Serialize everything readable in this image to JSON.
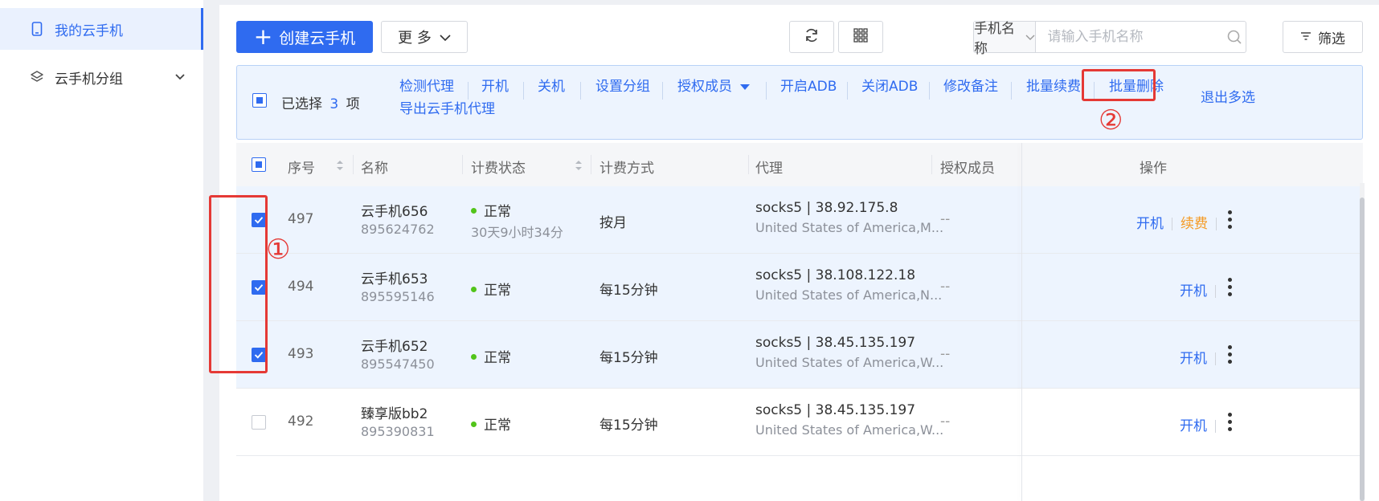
{
  "sidebar": {
    "items": [
      {
        "label": "我的云手机",
        "icon": "phone-icon",
        "active": true
      },
      {
        "label": "云手机分组",
        "icon": "layers-icon",
        "active": false
      }
    ]
  },
  "toolbar": {
    "create_label": "创建云手机",
    "more_label": "更 多",
    "search_field_label": "手机名称",
    "search_placeholder": "请输入手机名称",
    "filter_label": "筛选"
  },
  "selection_bar": {
    "prefix": "已选择",
    "count": "3",
    "suffix": "项",
    "actions": [
      "检测代理",
      "开机",
      "关机",
      "设置分组",
      "授权成员",
      "开启ADB",
      "关闭ADB",
      "修改备注",
      "批量续费",
      "批量删除"
    ],
    "action_row2": "导出云手机代理",
    "exit_label": "退出多选"
  },
  "table": {
    "headers": {
      "index": "序号",
      "name": "名称",
      "billing_status": "计费状态",
      "billing_method": "计费方式",
      "proxy": "代理",
      "members": "授权成员",
      "ops": "操作"
    },
    "rows": [
      {
        "checked": true,
        "index": "497",
        "name": "云手机656",
        "id": "895624762",
        "status": "正常",
        "remaining": "30天9小时34分",
        "method": "按月",
        "proxy": "socks5 | 38.92.175.8",
        "location": "United States of America,M...",
        "members": "--",
        "op_power": "开机",
        "op_renew": "续费"
      },
      {
        "checked": true,
        "index": "494",
        "name": "云手机653",
        "id": "895595146",
        "status": "正常",
        "remaining": "",
        "method": "每15分钟",
        "proxy": "socks5 | 38.108.122.18",
        "location": "United States of America,N...",
        "members": "--",
        "op_power": "开机",
        "op_renew": ""
      },
      {
        "checked": true,
        "index": "493",
        "name": "云手机652",
        "id": "895547450",
        "status": "正常",
        "remaining": "",
        "method": "每15分钟",
        "proxy": "socks5 | 38.45.135.197",
        "location": "United States of America,W...",
        "members": "--",
        "op_power": "开机",
        "op_renew": ""
      },
      {
        "checked": false,
        "index": "492",
        "name": "臻享版bb2",
        "id": "895390831",
        "status": "正常",
        "remaining": "",
        "method": "每15分钟",
        "proxy": "socks5 | 38.45.135.197",
        "location": "United States of America,W...",
        "members": "--",
        "op_power": "开机",
        "op_renew": ""
      }
    ]
  },
  "annotations": {
    "step1": "①",
    "step2": "②"
  },
  "colors": {
    "accent": "#2f6bf0",
    "renew": "#f59a23",
    "status_ok": "#52c41a",
    "annotation": "#e53935"
  }
}
